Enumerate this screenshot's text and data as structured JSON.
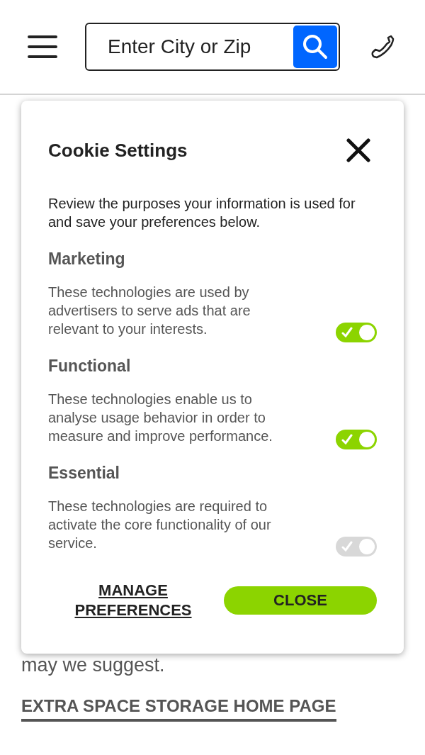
{
  "header": {
    "search": {
      "placeholder": "Enter City or Zip"
    }
  },
  "page": {
    "intro": "may we suggest.",
    "link": "EXTRA SPACE STORAGE HOME PAGE"
  },
  "dialog": {
    "title": "Cookie Settings",
    "description": "Review the purposes your information is used for and save your preferences below.",
    "categories": [
      {
        "name": "Marketing",
        "description": "These technologies are used by advertisers to serve ads that are relevant to your interests.",
        "checked": true,
        "disabled": false
      },
      {
        "name": "Functional",
        "description": "These technologies enable us to analyse usage behavior in order to measure and improve performance.",
        "checked": true,
        "disabled": false
      },
      {
        "name": "Essential",
        "description": "These technologies are required to activate the core functionality of our service.",
        "checked": true,
        "disabled": true
      }
    ],
    "manage": "MANAGE PREFERENCES",
    "close": "CLOSE"
  }
}
